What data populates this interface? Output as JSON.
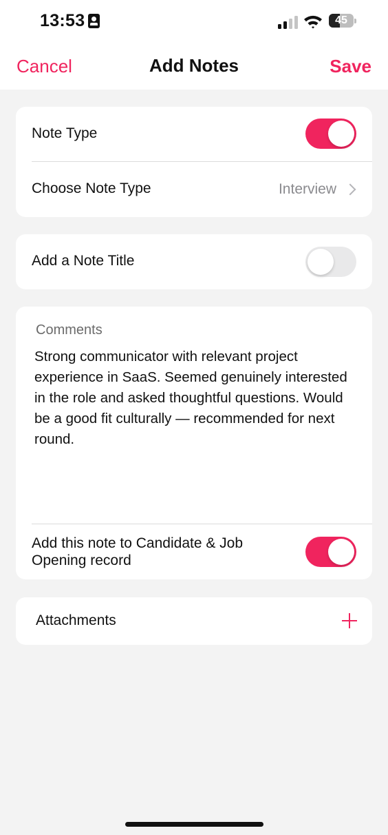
{
  "status_bar": {
    "time": "13:53",
    "battery_percent": "45",
    "battery_level": 0.45,
    "signal_bars_active": 2,
    "signal_bars_total": 4
  },
  "nav": {
    "cancel_label": "Cancel",
    "title": "Add Notes",
    "save_label": "Save"
  },
  "note_type_section": {
    "toggle_label": "Note Type",
    "toggle_on": true,
    "choose_label": "Choose Note Type",
    "choose_value": "Interview"
  },
  "note_title_section": {
    "toggle_label": "Add a Note Title",
    "toggle_on": false
  },
  "comments_section": {
    "label": "Comments",
    "text": "Strong communicator with relevant project experience in SaaS. Seemed genuinely interested in the role and asked thoughtful questions. Would be a good fit culturally — recommended for next round.",
    "add_to_record_label": "Add this note to Candidate & Job Opening record",
    "add_to_record_on": true
  },
  "attachments_section": {
    "label": "Attachments"
  },
  "colors": {
    "accent": "#f0245e",
    "background": "#f3f3f3",
    "card": "#ffffff",
    "toggle_off": "#e9e9ea",
    "secondary_text": "#8a8a8e"
  },
  "icons": {
    "id_card": "person-id-card-icon",
    "signal": "cellular-signal-icon",
    "wifi": "wifi-icon",
    "battery": "battery-icon",
    "chevron": "chevron-right-icon",
    "add": "plus-icon"
  }
}
